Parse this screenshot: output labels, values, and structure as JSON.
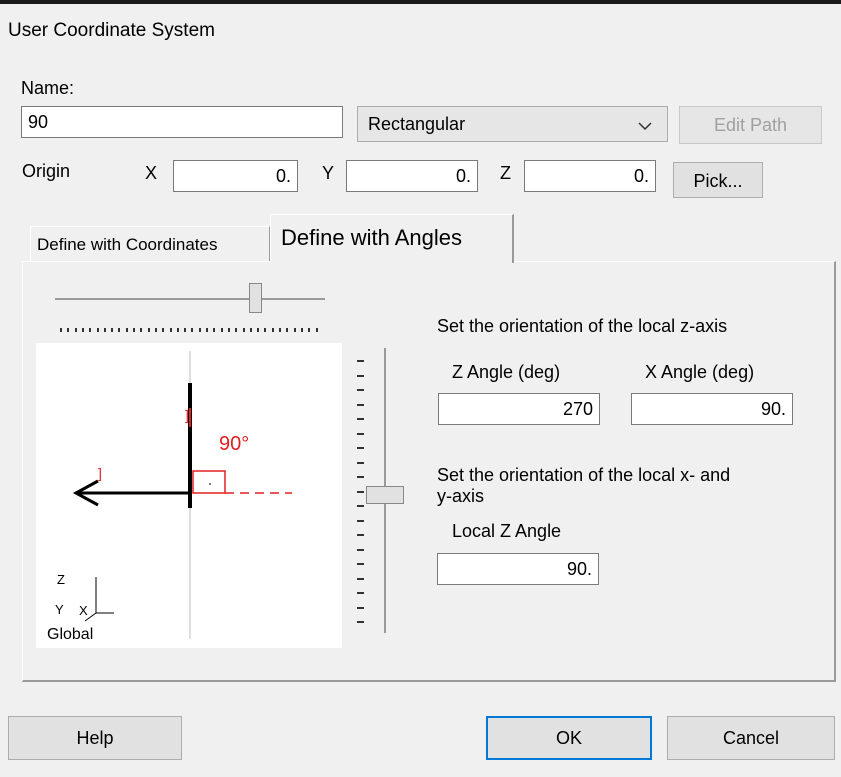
{
  "window": {
    "title": "User Coordinate System"
  },
  "name": {
    "label": "Name:",
    "value": "90"
  },
  "coord_type": {
    "selected": "Rectangular"
  },
  "edit_path": {
    "label": "Edit Path"
  },
  "origin": {
    "label": "Origin",
    "x_label": "X",
    "x_value": "0.",
    "y_label": "Y",
    "y_value": "0.",
    "z_label": "Z",
    "z_value": "0.",
    "pick_label": "Pick..."
  },
  "tabs": [
    {
      "label": "Define with Coordinates",
      "active": false
    },
    {
      "label": "Define with Angles",
      "active": true
    }
  ],
  "preview": {
    "angle_label": "90°",
    "marker_label_a": "]",
    "marker_label_b": "]",
    "global_z": "Z",
    "global_y": "Y",
    "global_x": "X",
    "global_label": "Global"
  },
  "z_axis": {
    "heading": "Set the orientation of the local z-axis",
    "z_angle_label": "Z Angle (deg)",
    "z_angle_value": "270",
    "x_angle_label": "X Angle (deg)",
    "x_angle_value": "90."
  },
  "xy_axis": {
    "heading_line1": "Set the orientation of the local x- and",
    "heading_line2": "y-axis",
    "local_z_label": "Local Z Angle",
    "local_z_value": "90."
  },
  "buttons": {
    "help": "Help",
    "ok": "OK",
    "cancel": "Cancel"
  },
  "colors": {
    "accent": "#0078d7",
    "marker": "#e02020"
  },
  "icons": {
    "dropdown": "chevron-down-icon"
  }
}
